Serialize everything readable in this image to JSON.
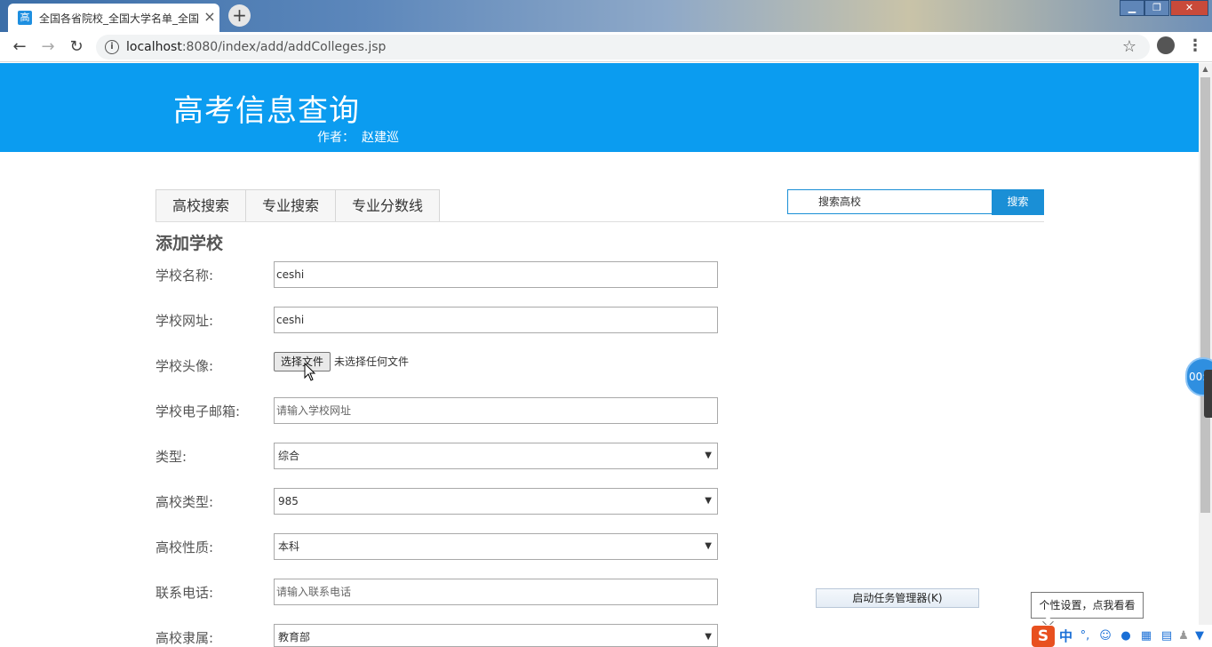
{
  "browser": {
    "tab_title": "全国各省院校_全国大学名单_全国",
    "tab_favicon": "高",
    "url_host": "localhost",
    "url_rest": ":8080/index/add/addColleges.jsp"
  },
  "header": {
    "title": "高考信息查询",
    "author_label": "作者：",
    "author_name": "赵建巡"
  },
  "nav": {
    "tabs": [
      "高校搜索",
      "专业搜索",
      "专业分数线"
    ]
  },
  "search": {
    "placeholder": "搜索高校",
    "button_label": "搜索"
  },
  "form": {
    "title": "添加学校",
    "fields": [
      {
        "label": "学校名称:",
        "value": "ceshi"
      },
      {
        "label": "学校网址:",
        "value": "ceshi"
      },
      {
        "label": "学校头像:",
        "button": "选择文件",
        "status": "未选择任何文件"
      },
      {
        "label": "学校电子邮箱:",
        "placeholder": "请输入学校网址"
      },
      {
        "label": "类型:",
        "selected": "综合"
      },
      {
        "label": "高校类型:",
        "selected": "985"
      },
      {
        "label": "高校性质:",
        "selected": "本科"
      },
      {
        "label": "联系电话:",
        "placeholder": "请输入联系电话"
      },
      {
        "label": "高校隶属:",
        "selected": "教育部"
      }
    ]
  },
  "overlays": {
    "task_manager_label": "启动任务管理器(K)",
    "tooltip": "个性设置，点我看看",
    "timer": "00:",
    "ime_mode": "中"
  }
}
